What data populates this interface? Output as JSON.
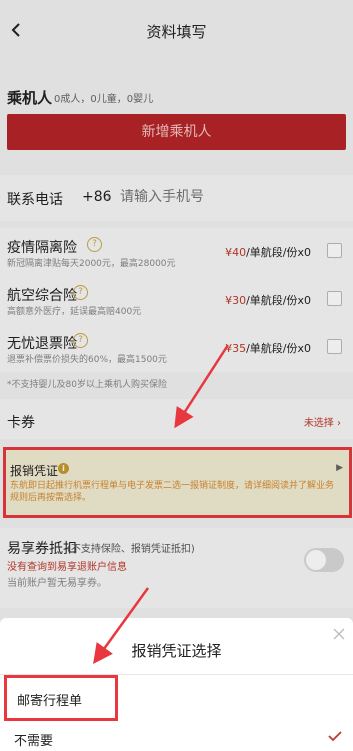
{
  "nav": {
    "title": "资料填写"
  },
  "passengers": {
    "label": "乘机人",
    "count": "0成人，0儿童，0婴儿",
    "add_button": "新增乘机人"
  },
  "phone": {
    "label": "联系电话",
    "code": "+86",
    "chevron": "›",
    "placeholder": "请输入手机号"
  },
  "insurance": [
    {
      "title": "疫情隔离险",
      "desc": "新冠隔离津贴每天2000元，最高28000元",
      "price": "¥40",
      "unit": "/单航段/份x0"
    },
    {
      "title": "航空综合险",
      "desc": "高额意外医疗，延误最高赔400元",
      "price": "¥30",
      "unit": "/单航段/份x0"
    },
    {
      "title": "无忧退票险",
      "desc": "退票补偿票价损失的60%，最高1500元",
      "price": "¥35",
      "unit": "/单航段/份x0"
    }
  ],
  "note": "*不支持婴儿及80岁以上乘机人购买保险",
  "coupon": {
    "label": "卡券",
    "status": "未选择 ›"
  },
  "voucher": {
    "title": "报销凭证",
    "info_icon": "i",
    "arrow": "▶",
    "desc": "东航即日起推行机票行程单与电子发票二选一报销证制度，请详细阅读并了解业务规则后再按需选择。"
  },
  "yixiang": {
    "title": "易享券抵扣",
    "subtitle": "(不支持保险、报销凭证抵扣)",
    "red_text": "没有查询到易享退账户信息",
    "gray_text": "当前账户暂无易享券。"
  },
  "sheet": {
    "title": "报销凭证选择",
    "options": [
      {
        "label": "邮寄行程单",
        "selected": false
      },
      {
        "label": "不需要",
        "selected": true
      }
    ]
  },
  "colors": {
    "brand_red": "#b52427",
    "highlight_red": "#e8373e",
    "price_red": "#c0392b",
    "voucher_bg": "#f1ecd2"
  }
}
